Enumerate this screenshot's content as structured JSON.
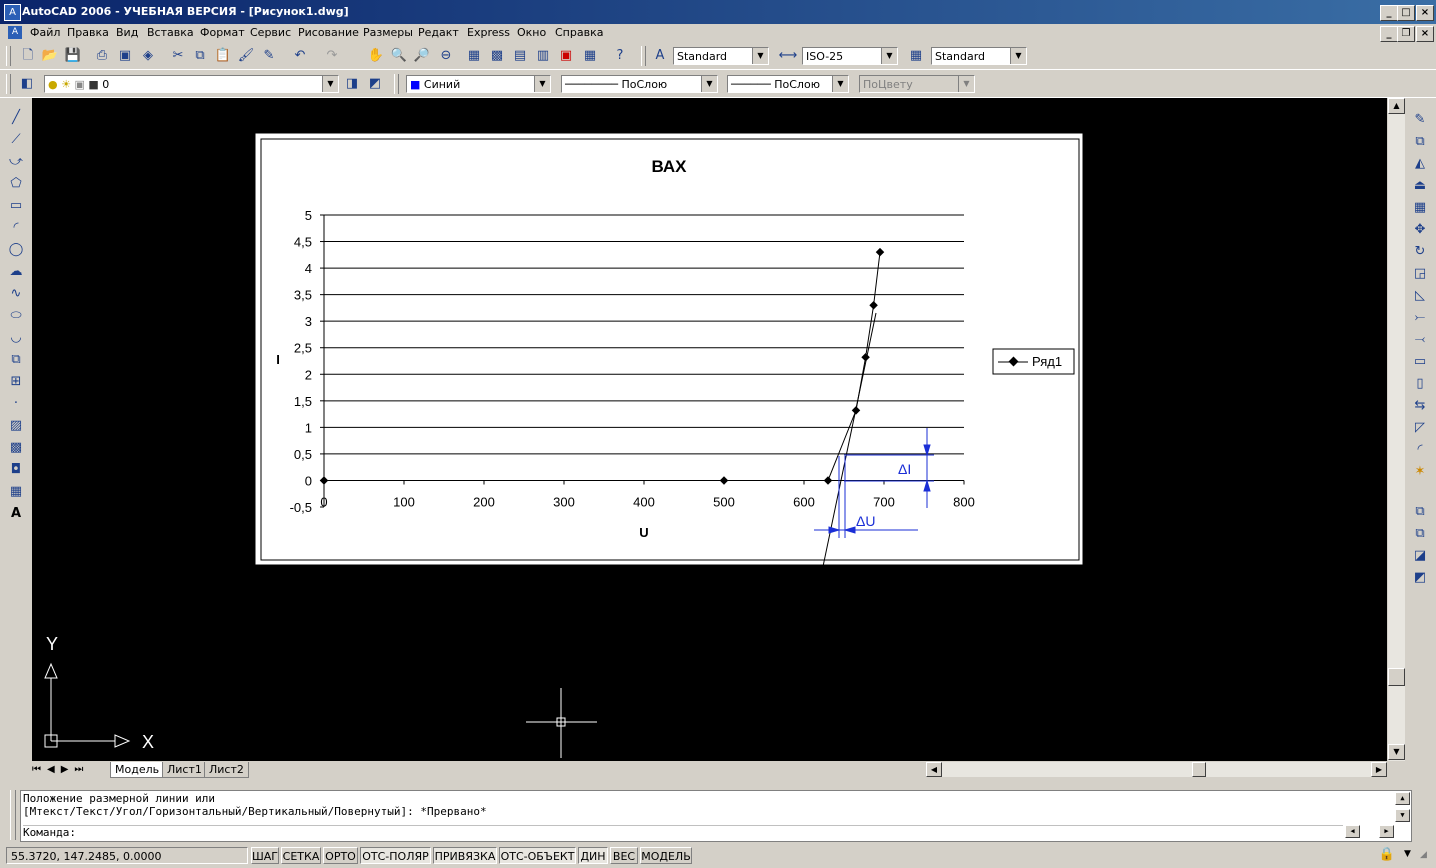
{
  "window": {
    "title": "AutoCAD 2006 - УЧЕБНАЯ ВЕРСИЯ - [Рисунок1.dwg]"
  },
  "menu": {
    "items": [
      "Файл",
      "Правка",
      "Вид",
      "Вставка",
      "Формат",
      "Сервис",
      "Рисование",
      "Размеры",
      "Редакт",
      "Express",
      "Окно",
      "Справка"
    ]
  },
  "toolbar1": {
    "text_style": "Standard",
    "dim_style": "ISO-25",
    "table_style": "Standard"
  },
  "toolbar2": {
    "layer": "0",
    "color": "Синий",
    "linetype": "ПоСлою",
    "lineweight": "ПоСлою",
    "plotstyle": "ПоЦвету"
  },
  "colors": {
    "canvas": "#000000",
    "chart_line": "#000000",
    "dimension": "#1a2ed6",
    "selected_color_swatch": "#0000ff"
  },
  "chart_data": {
    "type": "line",
    "title": "ВАХ",
    "xlabel": "U",
    "ylabel": "I",
    "xlim": [
      0,
      800
    ],
    "ylim": [
      -0.5,
      5
    ],
    "xticks": [
      "0",
      "100",
      "200",
      "300",
      "400",
      "500",
      "600",
      "700",
      "800"
    ],
    "yticks": [
      "-0,5",
      "0",
      "0,5",
      "1",
      "1,5",
      "2",
      "2,5",
      "3",
      "3,5",
      "4",
      "4,5",
      "5"
    ],
    "grid": "horizontal",
    "legend_position": "right",
    "series": [
      {
        "name": "Ряд1",
        "x": [
          0,
          500,
          630,
          665,
          677,
          687,
          695
        ],
        "y": [
          0,
          0,
          0,
          1.32,
          2.32,
          3.3,
          4.3
        ]
      }
    ]
  },
  "annotations": {
    "delta_i": "ΔI",
    "delta_u": "ΔU"
  },
  "ucs": {
    "x_label": "X",
    "y_label": "Y"
  },
  "layout_tabs": [
    "Модель",
    "Лист1",
    "Лист2"
  ],
  "command": {
    "line1": "Положение размерной линии или",
    "line2": "[Мтекст/Текст/Угол/Горизонтальный/Вертикальный/Повернутый]: *Прервано*",
    "prompt": "Команда:"
  },
  "status": {
    "coords": "55.3720, 147.2485, 0.0000",
    "buttons": [
      "ШАГ",
      "СЕТКА",
      "ОРТО",
      "ОТС-ПОЛЯР",
      "ПРИВЯЗКА",
      "ОТС-ОБЪЕКТ",
      "ДИН",
      "ВЕС",
      "МОДЕЛЬ"
    ]
  }
}
